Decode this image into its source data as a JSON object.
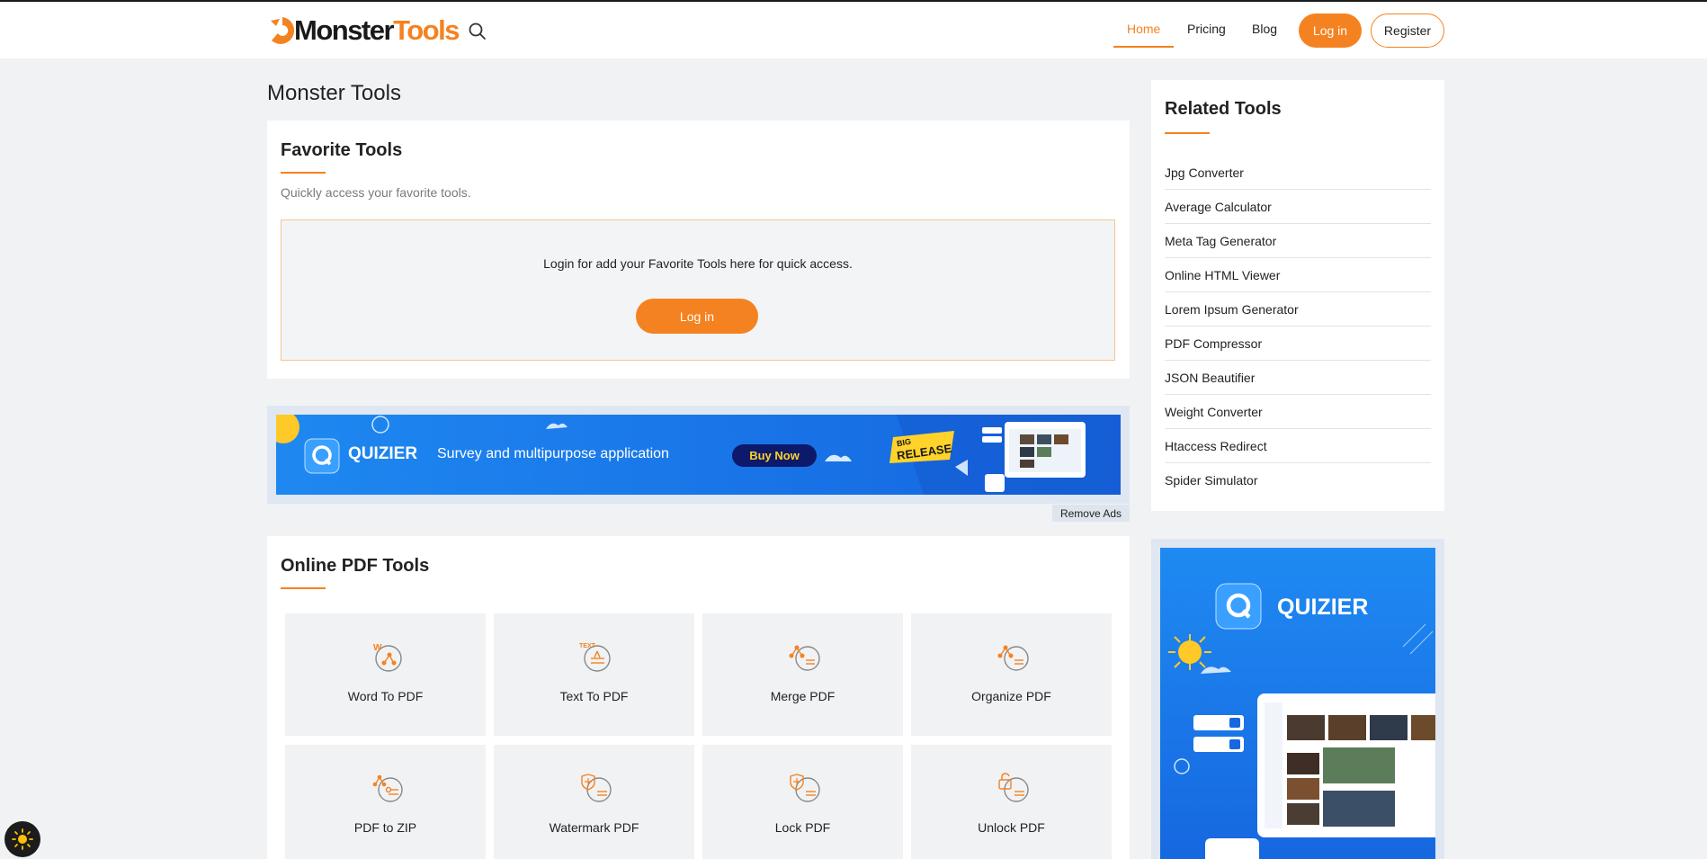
{
  "header": {
    "logo_part1": "Monster",
    "logo_part2": "Tools",
    "nav": {
      "home": "Home",
      "pricing": "Pricing",
      "blog": "Blog"
    },
    "login": "Log in",
    "register": "Register"
  },
  "page_title": "Monster Tools",
  "favorites": {
    "title": "Favorite Tools",
    "subtitle": "Quickly access your favorite tools.",
    "message": "Login for add your Favorite Tools here for quick access.",
    "login": "Log in"
  },
  "ad_banner": {
    "brand": "QUIZIER",
    "tagline": "Survey and multipurpose application",
    "cta": "Buy Now",
    "badge_line1": "BIG",
    "badge_line2": "RELEASE",
    "remove": "Remove Ads"
  },
  "pdf_tools": {
    "title": "Online PDF Tools",
    "items": [
      {
        "label": "Word To PDF",
        "icon": "word-to-pdf-icon"
      },
      {
        "label": "Text To PDF",
        "icon": "text-to-pdf-icon"
      },
      {
        "label": "Merge PDF",
        "icon": "merge-pdf-icon"
      },
      {
        "label": "Organize PDF",
        "icon": "organize-pdf-icon"
      },
      {
        "label": "PDF to ZIP",
        "icon": "pdf-to-zip-icon"
      },
      {
        "label": "Watermark PDF",
        "icon": "watermark-pdf-icon"
      },
      {
        "label": "Lock PDF",
        "icon": "lock-pdf-icon"
      },
      {
        "label": "Unlock PDF",
        "icon": "unlock-pdf-icon"
      }
    ]
  },
  "related": {
    "title": "Related Tools",
    "items": [
      "Jpg Converter",
      "Average Calculator",
      "Meta Tag Generator",
      "Online HTML Viewer",
      "Lorem Ipsum Generator",
      "PDF Compressor",
      "JSON Beautifier",
      "Weight Converter",
      "Htaccess Redirect",
      "Spider Simulator"
    ]
  },
  "side_ad": {
    "brand": "QUIZIER"
  },
  "colors": {
    "accent": "#f58220",
    "ad_blue": "#1e88f0",
    "bg": "#f1f2f4"
  }
}
